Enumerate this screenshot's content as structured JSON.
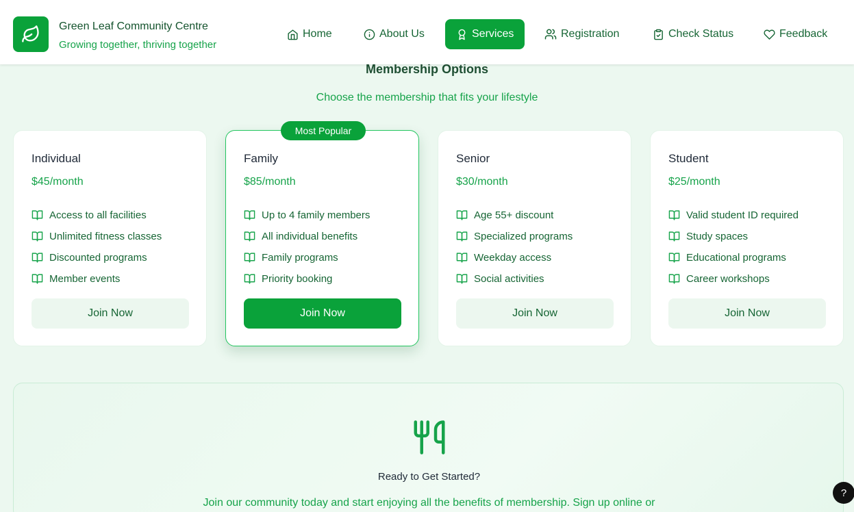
{
  "header": {
    "brand_title": "Green Leaf Community Centre",
    "brand_subtitle": "Growing together, thriving together",
    "nav": [
      {
        "label": "Home",
        "icon": "home-icon"
      },
      {
        "label": "About Us",
        "icon": "info-icon"
      },
      {
        "label": "Services",
        "icon": "award-icon",
        "active": true
      },
      {
        "label": "Registration",
        "icon": "users-icon"
      },
      {
        "label": "Check Status",
        "icon": "clipboard-check-icon"
      },
      {
        "label": "Feedback",
        "icon": "heart-icon"
      }
    ]
  },
  "section": {
    "title": "Membership Options",
    "subtitle": "Choose the membership that fits your lifestyle"
  },
  "plans": [
    {
      "name": "Individual",
      "price": "$45/month",
      "features": [
        "Access to all facilities",
        "Unlimited fitness classes",
        "Discounted programs",
        "Member events"
      ],
      "button": "Join Now"
    },
    {
      "name": "Family",
      "price": "$85/month",
      "badge": "Most Popular",
      "features": [
        "Up to 4 family members",
        "All individual benefits",
        "Family programs",
        "Priority booking"
      ],
      "button": "Join Now"
    },
    {
      "name": "Senior",
      "price": "$30/month",
      "features": [
        "Age 55+ discount",
        "Specialized programs",
        "Weekday access",
        "Social activities"
      ],
      "button": "Join Now"
    },
    {
      "name": "Student",
      "price": "$25/month",
      "features": [
        "Valid student ID required",
        "Study spaces",
        "Educational programs",
        "Career workshops"
      ],
      "button": "Join Now"
    }
  ],
  "cta": {
    "icon": "utensils-icon",
    "title": "Ready to Get Started?",
    "text": "Join our community today and start enjoying all the benefits of membership. Sign up online or"
  },
  "help": {
    "label": "?"
  },
  "colors": {
    "brand_green": "#0aa23a",
    "text_green": "#16a34a",
    "dark_green": "#166534",
    "page_bg": "#ecf8f0"
  }
}
